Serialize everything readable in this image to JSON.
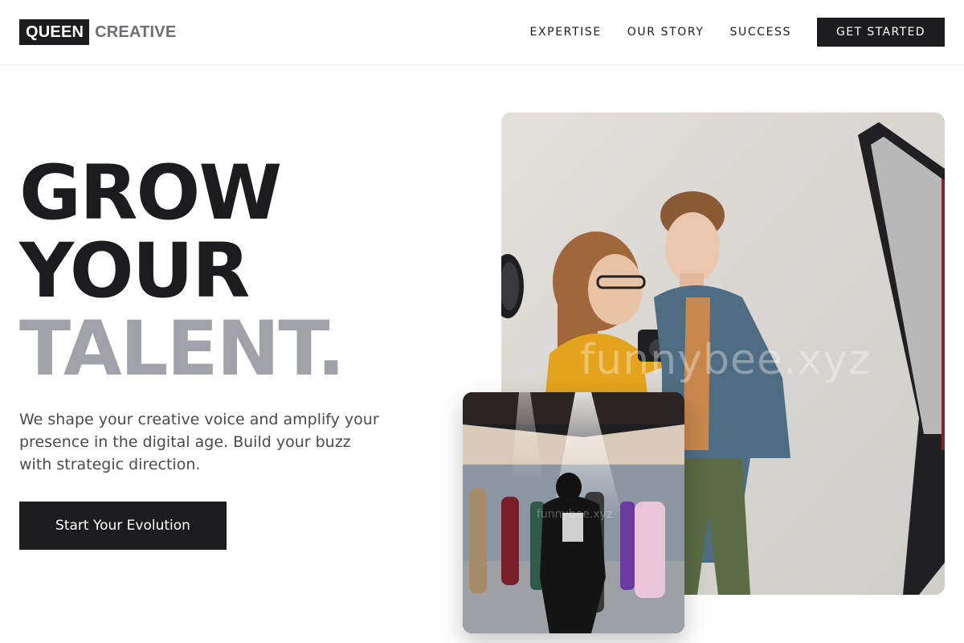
{
  "brand": {
    "primary": "QUEEN",
    "secondary": "CREATIVE"
  },
  "nav": {
    "links": [
      {
        "label": "EXPERTISE"
      },
      {
        "label": "OUR STORY"
      },
      {
        "label": "SUCCESS"
      }
    ],
    "cta_label": "GET STARTED"
  },
  "hero": {
    "headline": [
      "GROW",
      "YOUR",
      "TALENT."
    ],
    "subtext": "We shape your creative voice and amplify your presence in the digital age. Build your buzz with strategic direction.",
    "cta_label": "Start Your Evolution"
  },
  "images": {
    "main_watermark": "funnybee.xyz",
    "small_watermark": "funnybee.xyz"
  },
  "colors": {
    "primary": "#1c1c1e",
    "muted_headline": "#a1a1aa",
    "body_text": "#4a4a4f"
  }
}
